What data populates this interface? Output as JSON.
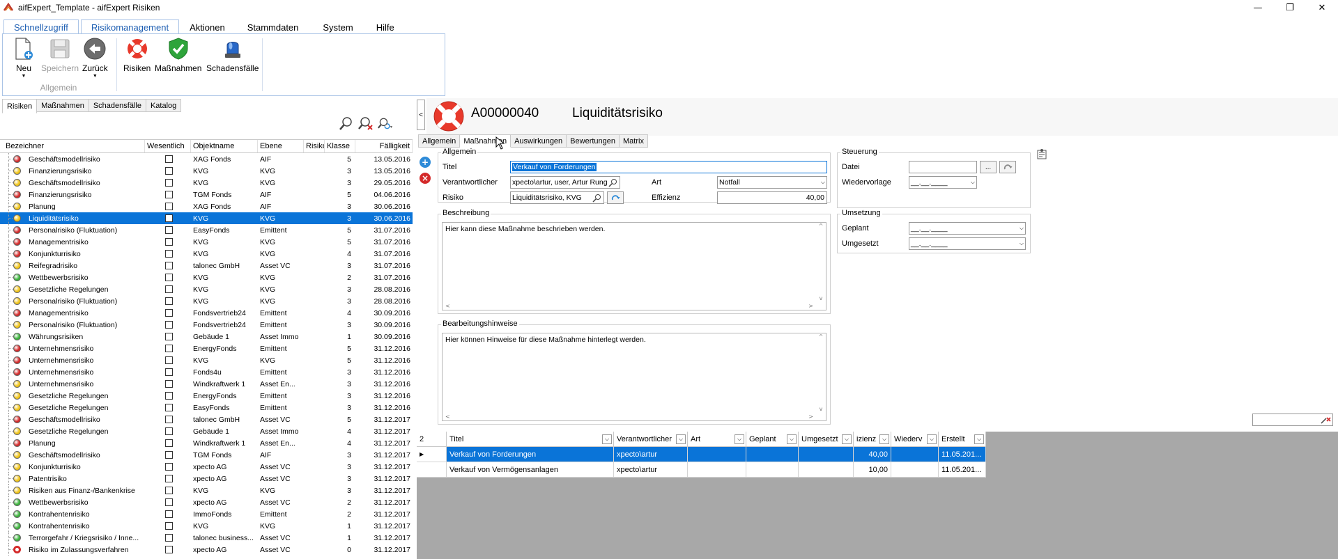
{
  "window": {
    "title": "aifExpert_Template - aifExpert Risiken",
    "minimize": "—",
    "maximize": "❐",
    "close": "✕"
  },
  "ribbon": {
    "tabs": [
      "Schnellzugriff",
      "Risikomanagement",
      "Aktionen",
      "Stammdaten",
      "System",
      "Hilfe"
    ],
    "active_tab": "Risikomanagement",
    "buttons": {
      "neu": "Neu",
      "speichern": "Speichern",
      "zurueck": "Zurück",
      "risiken": "Risiken",
      "massnahmen": "Maßnahmen",
      "schadensfaelle": "Schadensfälle"
    },
    "group_label": "Allgemein"
  },
  "left_tabs": [
    "Risiken",
    "Maßnahmen",
    "Schadensfälle",
    "Katalog"
  ],
  "left_grid": {
    "columns": [
      "Bezeichner",
      "Wesentlich",
      "Objektname",
      "Ebene",
      "Risiko",
      "Klasse",
      "Fälligkeit"
    ],
    "rows": [
      {
        "status": "red",
        "name": "Geschäftsmodellrisiko",
        "obj": "XAG Fonds",
        "ebene": "AIF",
        "klasse": "5",
        "date": "13.05.2016"
      },
      {
        "status": "yellow",
        "name": "Finanzierungsrisiko",
        "obj": "KVG",
        "ebene": "KVG",
        "klasse": "3",
        "date": "13.05.2016"
      },
      {
        "status": "yellow",
        "name": "Geschäftsmodellrisiko",
        "obj": "KVG",
        "ebene": "KVG",
        "klasse": "3",
        "date": "29.05.2016"
      },
      {
        "status": "red",
        "name": "Finanzierungsrisiko",
        "obj": "TGM Fonds",
        "ebene": "AIF",
        "klasse": "5",
        "date": "04.06.2016"
      },
      {
        "status": "yellow",
        "name": "Planung",
        "obj": "XAG Fonds",
        "ebene": "AIF",
        "klasse": "3",
        "date": "30.06.2016"
      },
      {
        "status": "yellow",
        "name": "Liquiditätsrisiko",
        "obj": "KVG",
        "ebene": "KVG",
        "klasse": "3",
        "date": "30.06.2016",
        "selected": true
      },
      {
        "status": "red",
        "name": "Personalrisiko (Fluktuation)",
        "obj": "EasyFonds",
        "ebene": "Emittent",
        "klasse": "5",
        "date": "31.07.2016"
      },
      {
        "status": "red",
        "name": "Managementrisiko",
        "obj": "KVG",
        "ebene": "KVG",
        "klasse": "5",
        "date": "31.07.2016"
      },
      {
        "status": "red",
        "name": "Konjunkturrisiko",
        "obj": "KVG",
        "ebene": "KVG",
        "klasse": "4",
        "date": "31.07.2016"
      },
      {
        "status": "yellow",
        "name": "Reifegradrisiko",
        "obj": "talonec GmbH",
        "ebene": "Asset VC",
        "klasse": "3",
        "date": "31.07.2016"
      },
      {
        "status": "green",
        "name": "Wettbewerbsrisiko",
        "obj": "KVG",
        "ebene": "KVG",
        "klasse": "2",
        "date": "31.07.2016"
      },
      {
        "status": "yellow",
        "name": "Gesetzliche Regelungen",
        "obj": "KVG",
        "ebene": "KVG",
        "klasse": "3",
        "date": "28.08.2016"
      },
      {
        "status": "yellow",
        "name": "Personalrisiko (Fluktuation)",
        "obj": "KVG",
        "ebene": "KVG",
        "klasse": "3",
        "date": "28.08.2016"
      },
      {
        "status": "red",
        "name": "Managementrisiko",
        "obj": "Fondsvertrieb24",
        "ebene": "Emittent",
        "klasse": "4",
        "date": "30.09.2016"
      },
      {
        "status": "yellow",
        "name": "Personalrisiko (Fluktuation)",
        "obj": "Fondsvertrieb24",
        "ebene": "Emittent",
        "klasse": "3",
        "date": "30.09.2016"
      },
      {
        "status": "green",
        "name": "Währungsrisiken",
        "obj": "Gebäude 1",
        "ebene": "Asset Immo",
        "klasse": "1",
        "date": "30.09.2016"
      },
      {
        "status": "red",
        "name": "Unternehmensrisiko",
        "obj": "EnergyFonds",
        "ebene": "Emittent",
        "klasse": "5",
        "date": "31.12.2016"
      },
      {
        "status": "red",
        "name": "Unternehmensrisiko",
        "obj": "KVG",
        "ebene": "KVG",
        "klasse": "5",
        "date": "31.12.2016"
      },
      {
        "status": "red",
        "name": "Unternehmensrisiko",
        "obj": "Fonds4u",
        "ebene": "Emittent",
        "klasse": "3",
        "date": "31.12.2016"
      },
      {
        "status": "yellow",
        "name": "Unternehmensrisiko",
        "obj": "Windkraftwerk 1",
        "ebene": "Asset En...",
        "klasse": "3",
        "date": "31.12.2016"
      },
      {
        "status": "yellow",
        "name": "Gesetzliche Regelungen",
        "obj": "EnergyFonds",
        "ebene": "Emittent",
        "klasse": "3",
        "date": "31.12.2016"
      },
      {
        "status": "yellow",
        "name": "Gesetzliche Regelungen",
        "obj": "EasyFonds",
        "ebene": "Emittent",
        "klasse": "3",
        "date": "31.12.2016"
      },
      {
        "status": "red",
        "name": "Geschäftsmodellrisiko",
        "obj": "talonec GmbH",
        "ebene": "Asset VC",
        "klasse": "5",
        "date": "31.12.2017"
      },
      {
        "status": "yellow",
        "name": "Gesetzliche Regelungen",
        "obj": "Gebäude 1",
        "ebene": "Asset Immo",
        "klasse": "4",
        "date": "31.12.2017"
      },
      {
        "status": "red",
        "name": "Planung",
        "obj": "Windkraftwerk 1",
        "ebene": "Asset En...",
        "klasse": "4",
        "date": "31.12.2017"
      },
      {
        "status": "yellow",
        "name": "Geschäftsmodellrisiko",
        "obj": "TGM Fonds",
        "ebene": "AIF",
        "klasse": "3",
        "date": "31.12.2017"
      },
      {
        "status": "yellow",
        "name": "Konjunkturrisiko",
        "obj": "xpecto AG",
        "ebene": "Asset VC",
        "klasse": "3",
        "date": "31.12.2017"
      },
      {
        "status": "yellow",
        "name": "Patentrisiko",
        "obj": "xpecto AG",
        "ebene": "Asset VC",
        "klasse": "3",
        "date": "31.12.2017"
      },
      {
        "status": "yellow",
        "name": "Risiken aus Finanz-/Bankenkrise",
        "obj": "KVG",
        "ebene": "KVG",
        "klasse": "3",
        "date": "31.12.2017"
      },
      {
        "status": "green",
        "name": "Wettbewerbsrisiko",
        "obj": "xpecto AG",
        "ebene": "Asset VC",
        "klasse": "2",
        "date": "31.12.2017"
      },
      {
        "status": "green",
        "name": "Kontrahentenrisiko",
        "obj": "ImmoFonds",
        "ebene": "Emittent",
        "klasse": "2",
        "date": "31.12.2017"
      },
      {
        "status": "green",
        "name": "Kontrahentenrisiko",
        "obj": "KVG",
        "ebene": "KVG",
        "klasse": "1",
        "date": "31.12.2017"
      },
      {
        "status": "green",
        "name": "Terrorgefahr / Kriegsrisiko / Inne...",
        "obj": "talonec business...",
        "ebene": "Asset VC",
        "klasse": "1",
        "date": "31.12.2017"
      },
      {
        "status": "ring",
        "name": "Risiko im Zulassungsverfahren",
        "obj": "xpecto AG",
        "ebene": "Asset VC",
        "klasse": "0",
        "date": "31.12.2017"
      }
    ]
  },
  "record": {
    "id": "A00000040",
    "title": "Liquiditätsrisiko"
  },
  "detail_tabs": [
    "Allgemein",
    "Maßnahmen",
    "Auswirkungen",
    "Bewertungen",
    "Matrix"
  ],
  "detail_active_tab": "Maßnahmen",
  "form": {
    "allgemein_legend": "Allgemein",
    "titel_label": "Titel",
    "titel_value": "Verkauf von Forderungen",
    "verantwortlicher_label": "Verantwortlicher",
    "verantwortlicher_value": "xpecto\\artur, user, Artur Rung",
    "art_label": "Art",
    "art_value": "Notfall",
    "risiko_label": "Risiko",
    "risiko_value": "Liquiditätsrisiko, KVG",
    "effizienz_label": "Effizienz",
    "effizienz_value": "40,00",
    "beschreibung_legend": "Beschreibung",
    "beschreibung_text": "Hier kann diese Maßnahme beschrieben werden.",
    "hinweise_legend": "Bearbeitungshinweise",
    "hinweise_text": "Hier können Hinweise für diese Maßnahme hinterlegt werden.",
    "steuerung_legend": "Steuerung",
    "datei_label": "Datei",
    "datei_btn": "...",
    "wiedervorlage_label": "Wiedervorlage",
    "date_placeholder": "__.__.____",
    "umsetzung_legend": "Umsetzung",
    "geplant_label": "Geplant",
    "umgesetzt_label": "Umgesetzt"
  },
  "bottom_grid": {
    "count": "2",
    "columns": [
      "Titel",
      "Verantwortlicher",
      "Art",
      "Geplant",
      "Umgesetzt",
      "izienz",
      "Wiederv",
      "Erstellt"
    ],
    "rows": [
      {
        "titel": "Verkauf von Forderungen",
        "verantwortlicher": "xpecto\\artur",
        "art": "",
        "geplant": "",
        "umgesetzt": "",
        "effizienz": "40,00",
        "wiedervorlage": "",
        "erstellt": "11.05.201...",
        "selected": true
      },
      {
        "titel": "Verkauf von Vermögensanlagen",
        "verantwortlicher": "xpecto\\artur",
        "art": "",
        "geplant": "",
        "umgesetzt": "",
        "effizienz": "10,00",
        "wiedervorlage": "",
        "erstellt": "11.05.201..."
      }
    ]
  },
  "colors": {
    "accent": "#0a74d8",
    "red": "#d42a2a",
    "yellow": "#f0c419",
    "green": "#3cb33c"
  }
}
